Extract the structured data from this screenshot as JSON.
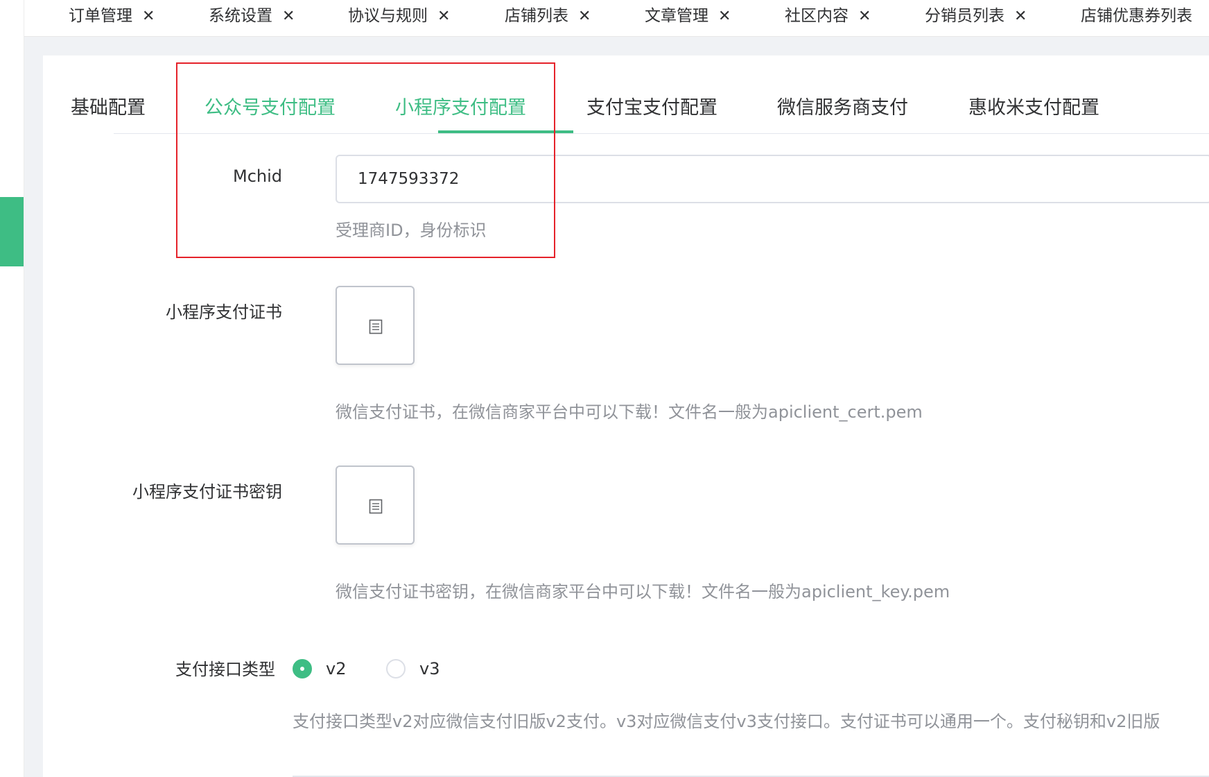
{
  "topTabs": [
    {
      "label": "订单管理"
    },
    {
      "label": "系统设置"
    },
    {
      "label": "协议与规则"
    },
    {
      "label": "店铺列表"
    },
    {
      "label": "文章管理"
    },
    {
      "label": "社区内容"
    },
    {
      "label": "分销员列表"
    },
    {
      "label": "店铺优惠券列表"
    }
  ],
  "closeGlyph": "✕",
  "subTabs": [
    {
      "label": "基础配置"
    },
    {
      "label": "公众号支付配置"
    },
    {
      "label": "小程序支付配置"
    },
    {
      "label": "支付宝支付配置"
    },
    {
      "label": "微信服务商支付"
    },
    {
      "label": "惠收米支付配置"
    }
  ],
  "activeSubTab": "小程序支付配置",
  "form": {
    "mchid": {
      "label": "Mchid",
      "value": "1747593372",
      "hint": "受理商ID，身份标识"
    },
    "cert": {
      "label": "小程序支付证书",
      "hint": "微信支付证书，在微信商家平台中可以下载！文件名一般为apiclient_cert.pem",
      "icon": "file-icon"
    },
    "certKey": {
      "label": "小程序支付证书密钥",
      "hint": "微信支付证书密钥，在微信商家平台中可以下载！文件名一般为apiclient_key.pem",
      "icon": "file-icon"
    },
    "apiType": {
      "label": "支付接口类型",
      "options": [
        {
          "label": "v2",
          "checked": true
        },
        {
          "label": "v3",
          "checked": false
        }
      ],
      "hint": "支付接口类型v2对应微信支付旧版v2支付。v3对应微信支付v3支付接口。支付证书可以通用一个。支付秘钥和v2旧版"
    }
  },
  "colors": {
    "accent": "#3ebd84",
    "highlight": "#e5222a"
  }
}
